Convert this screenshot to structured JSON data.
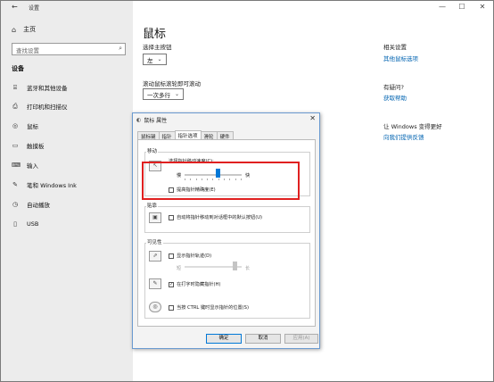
{
  "window": {
    "back_glyph": "←",
    "title": "设置",
    "controls": [
      "—",
      "☐",
      "✕"
    ]
  },
  "sidebar": {
    "home": "主页",
    "search_placeholder": "查找设置",
    "section_title": "设备",
    "items": [
      {
        "icon": "bluetooth-icon",
        "glyph": "⌸",
        "label": "蓝牙和其他设备"
      },
      {
        "icon": "printer-icon",
        "glyph": "⎙",
        "label": "打印机和扫描仪"
      },
      {
        "icon": "mouse-icon",
        "glyph": "◎",
        "label": "鼠标"
      },
      {
        "icon": "touchpad-icon",
        "glyph": "▭",
        "label": "触摸板"
      },
      {
        "icon": "typing-icon",
        "glyph": "⌨",
        "label": "输入"
      },
      {
        "icon": "pen-icon",
        "glyph": "✎",
        "label": "笔和 Windows Ink"
      },
      {
        "icon": "autoplay-icon",
        "glyph": "◷",
        "label": "自动播放"
      },
      {
        "icon": "usb-icon",
        "glyph": "▯",
        "label": "USB"
      }
    ]
  },
  "main": {
    "title": "鼠标",
    "primary_button_label": "选择主按钮",
    "primary_button_value": "左",
    "scroll_label": "滚动鼠标滚轮即可滚动",
    "scroll_value": "一次多行",
    "related_title": "相关设置",
    "related_link": "其他鼠标选项",
    "help_title": "有疑问?",
    "help_link": "获取帮助",
    "improve_title": "让 Windows 变得更好",
    "improve_link": "向我们提供反馈"
  },
  "dialog": {
    "title": "鼠标 属性",
    "close": "✕",
    "tabs": [
      "鼠标键",
      "指针",
      "指针选项",
      "滑轮",
      "硬件"
    ],
    "active_tab": 2,
    "motion": {
      "group": "移动",
      "speed_label": "选择指针移动速度(C):",
      "slow": "慢",
      "fast": "快",
      "speed_level": 0.6,
      "precision_label": "提高指针精确度(E)",
      "precision_checked": false
    },
    "snap": {
      "group": "贴靠",
      "label": "自动将指针移动到对话框中的默认按钮(U)",
      "checked": false
    },
    "visibility": {
      "group": "可见性",
      "trails_label": "显示指针轨迹(D)",
      "trails_checked": false,
      "short": "短",
      "long": "长",
      "hide_label": "在打字时隐藏指针(H)",
      "hide_checked": true,
      "ctrl_label": "当按 CTRL 键时显示指针的位置(S)",
      "ctrl_checked": false
    },
    "buttons": {
      "ok": "确定",
      "cancel": "取消",
      "apply": "应用(A)"
    }
  },
  "colors": {
    "accent": "#0078d7",
    "link": "#0063b1",
    "highlight": "#e02020"
  }
}
